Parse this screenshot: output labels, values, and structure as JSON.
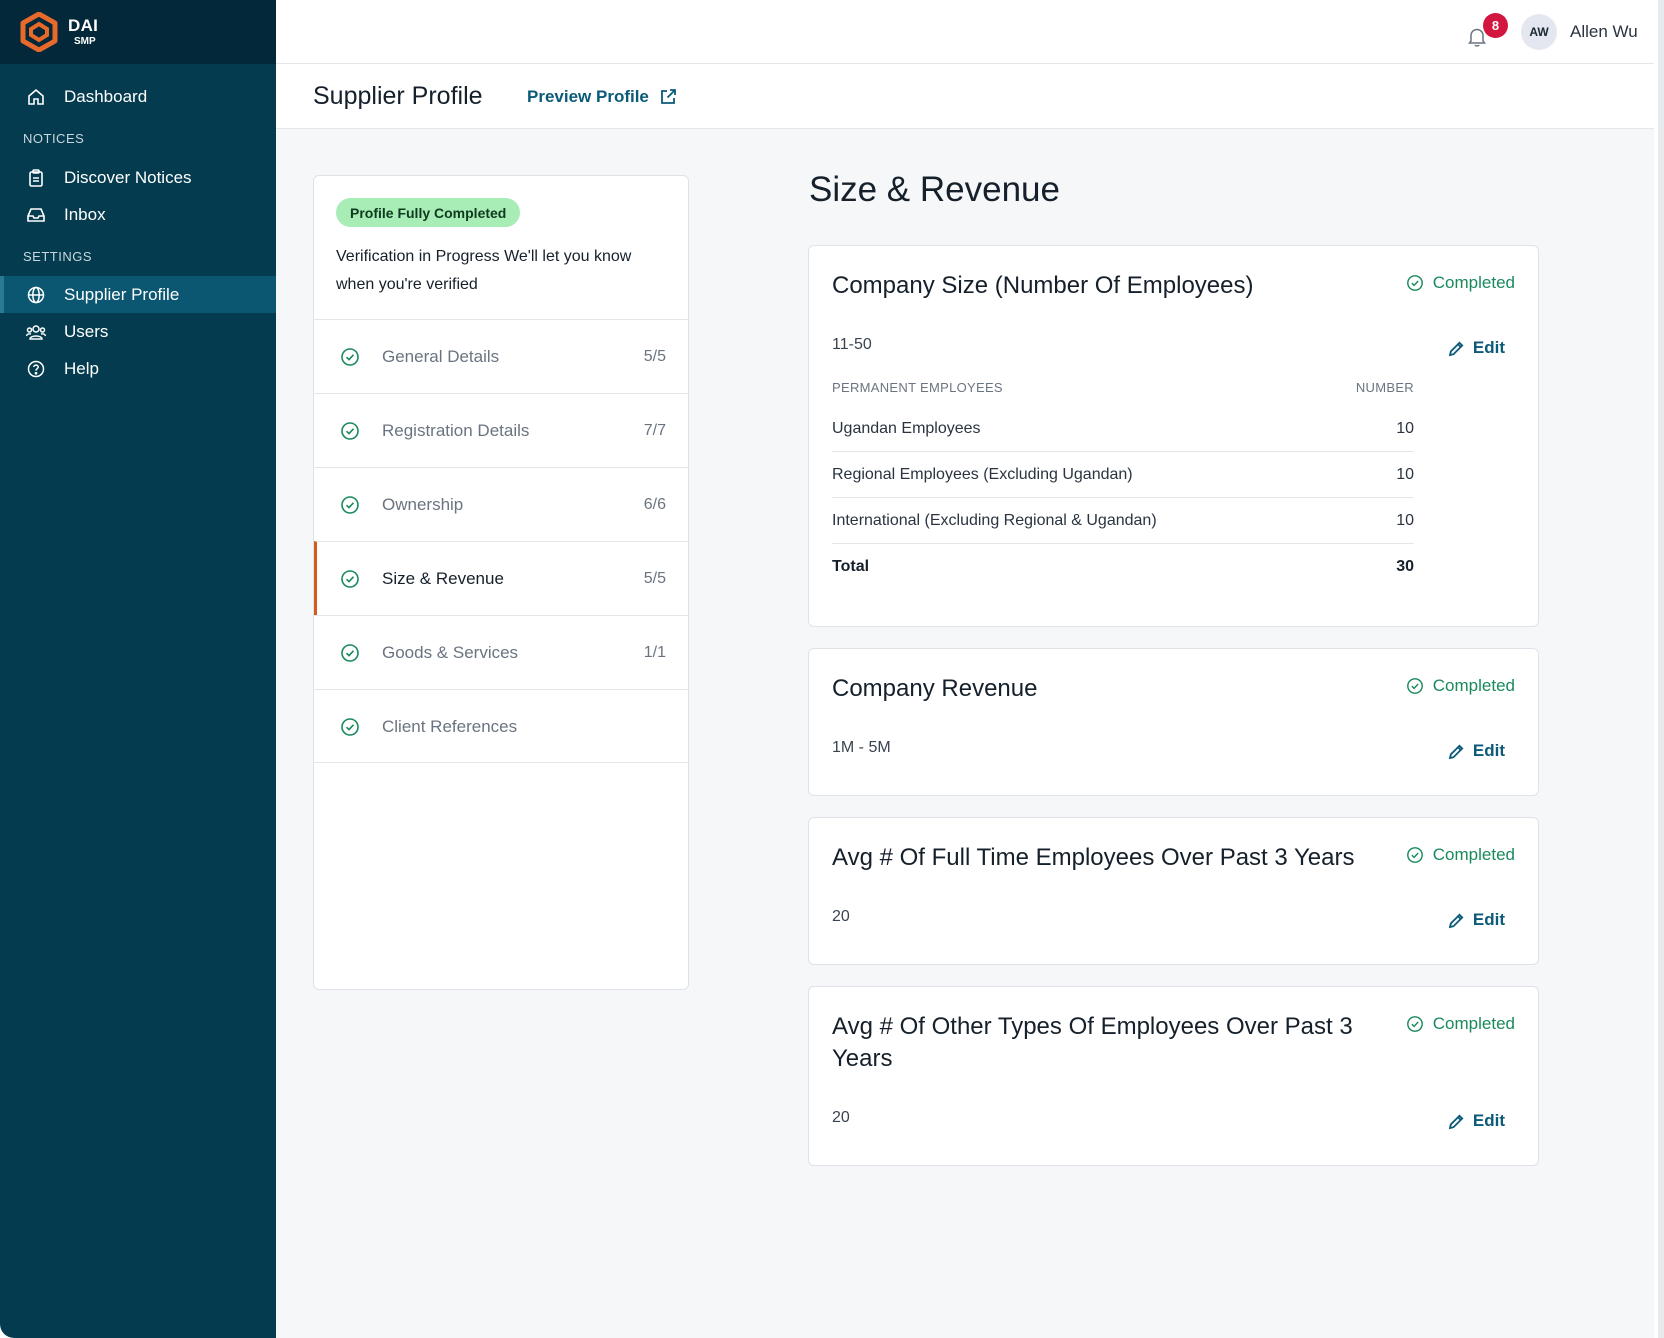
{
  "brand": {
    "name": "DAI",
    "sub": "SMP",
    "accent": "#e8692a"
  },
  "sidebar": {
    "dashboard": "Dashboard",
    "notices_section": "NOTICES",
    "discover_notices": "Discover Notices",
    "inbox": "Inbox",
    "settings_section": "SETTINGS",
    "supplier_profile": "Supplier Profile",
    "users": "Users",
    "help": "Help"
  },
  "topbar": {
    "notification_count": "8",
    "avatar_initials": "AW",
    "user_name": "Allen Wu"
  },
  "page_header": {
    "title": "Supplier Profile",
    "preview_link": "Preview Profile"
  },
  "progress": {
    "pill": "Profile Fully Completed",
    "verification_text": "Verification in Progress   We'll let you know when you're verified",
    "sections": [
      {
        "label": "General Details",
        "count": "5/5"
      },
      {
        "label": "Registration Details",
        "count": "7/7"
      },
      {
        "label": "Ownership",
        "count": "6/6"
      },
      {
        "label": "Size & Revenue",
        "count": "5/5"
      },
      {
        "label": "Goods & Services",
        "count": "1/1"
      },
      {
        "label": "Client References",
        "count": ""
      }
    ]
  },
  "main": {
    "title": "Size & Revenue",
    "status_label": "Completed",
    "edit_label": "Edit",
    "company_size": {
      "title": "Company Size (Number Of Employees)",
      "value": "11-50",
      "table_header_left": "PERMANENT EMPLOYEES",
      "table_header_right": "NUMBER",
      "rows": [
        {
          "label": "Ugandan Employees",
          "value": "10"
        },
        {
          "label": "Regional Employees (Excluding Ugandan)",
          "value": "10"
        },
        {
          "label": "International (Excluding Regional & Ugandan)",
          "value": "10"
        }
      ],
      "total_label": "Total",
      "total_value": "30"
    },
    "company_revenue": {
      "title": "Company Revenue",
      "value": "1M - 5M"
    },
    "avg_full_time": {
      "title": "Avg # Of Full Time Employees Over Past 3 Years",
      "value": "20"
    },
    "avg_other": {
      "title": "Avg # Of Other Types Of Employees Over Past 3 Years",
      "value": "20"
    }
  }
}
